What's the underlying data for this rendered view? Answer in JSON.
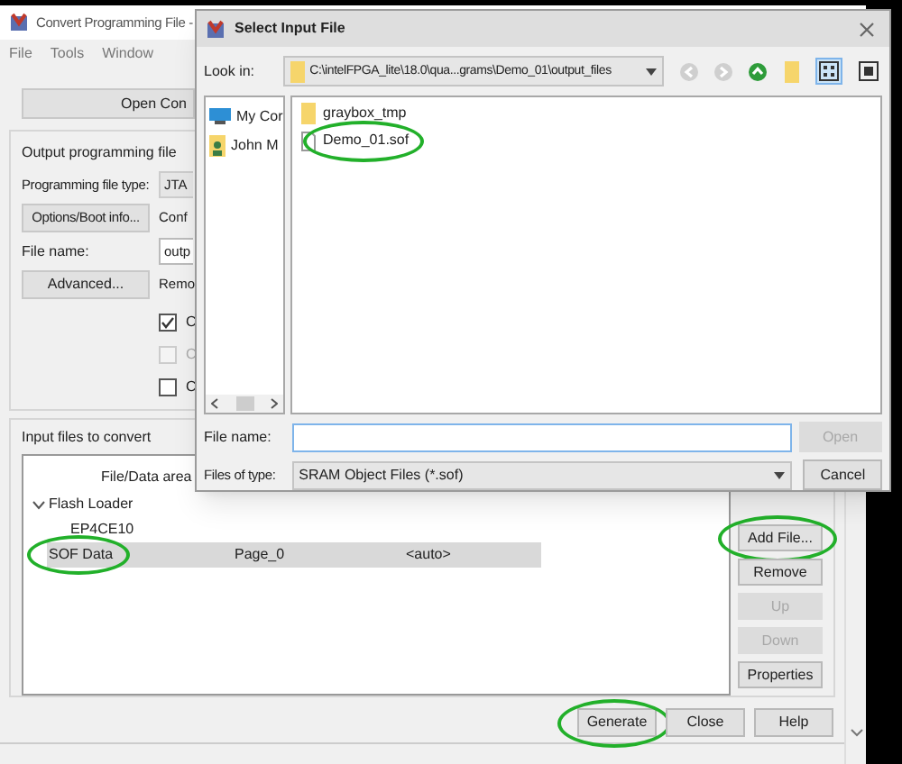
{
  "main_window": {
    "title": "Convert Programming File -",
    "menu": [
      "File",
      "Tools",
      "Window"
    ],
    "setup_button": "Open Con",
    "output_section": {
      "heading": "Output programming file",
      "type_label": "Programming file type:",
      "type_value": "JTA",
      "options_button": "Options/Boot info...",
      "options_note": "Conf",
      "file_name_label": "File name:",
      "file_name_value": "outp",
      "advanced_button": "Advanced...",
      "advanced_note": "Remo",
      "checkboxes": [
        {
          "label": "C",
          "checked": true,
          "disabled": false
        },
        {
          "label": "C",
          "checked": false,
          "disabled": true
        },
        {
          "label": "C",
          "checked": false,
          "disabled": false
        }
      ]
    },
    "input_section": {
      "heading": "Input files to convert",
      "columns": [
        "File/Data area"
      ],
      "rows": [
        {
          "label": "Flash Loader",
          "expanded": true,
          "selected": false,
          "highlighted": false,
          "children": [
            {
              "label": "EP4CE10",
              "selected": false,
              "highlighted": false
            }
          ]
        },
        {
          "label": "SOF Data",
          "column_2": "Page_0",
          "column_3": "<auto>",
          "selected": true,
          "highlighted": true
        }
      ],
      "side_buttons": [
        {
          "label": "Add File...",
          "disabled": false,
          "highlighted": true
        },
        {
          "label": "Remove",
          "disabled": false,
          "highlighted": false
        },
        {
          "label": "Up",
          "disabled": true,
          "highlighted": false
        },
        {
          "label": "Down",
          "disabled": true,
          "highlighted": false
        },
        {
          "label": "Properties",
          "disabled": false,
          "highlighted": false
        }
      ]
    },
    "footer_buttons": [
      {
        "label": "Generate",
        "highlighted": true
      },
      {
        "label": "Close",
        "highlighted": false
      },
      {
        "label": "Help",
        "highlighted": false
      }
    ]
  },
  "dialog": {
    "title": "Select Input File",
    "look_in_label": "Look in:",
    "look_in_path": "C:\\intelFPGA_lite\\18.0\\qua...grams\\Demo_01\\output_files",
    "places": [
      {
        "label": "My Cor",
        "kind": "computer"
      },
      {
        "label": "John M",
        "kind": "user"
      }
    ],
    "files": [
      {
        "name": "graybox_tmp",
        "kind": "folder",
        "highlighted": false
      },
      {
        "name": "Demo_01.sof",
        "kind": "file",
        "highlighted": true
      }
    ],
    "view_modes": [
      {
        "kind": "list",
        "selected": true
      },
      {
        "kind": "detail",
        "selected": false
      }
    ],
    "file_name_label": "File name:",
    "open_button": {
      "label": "Open",
      "disabled": true
    },
    "type_label": "Files of type:",
    "type_value": "SRAM Object Files (*.sof)",
    "cancel_button": "Cancel"
  }
}
